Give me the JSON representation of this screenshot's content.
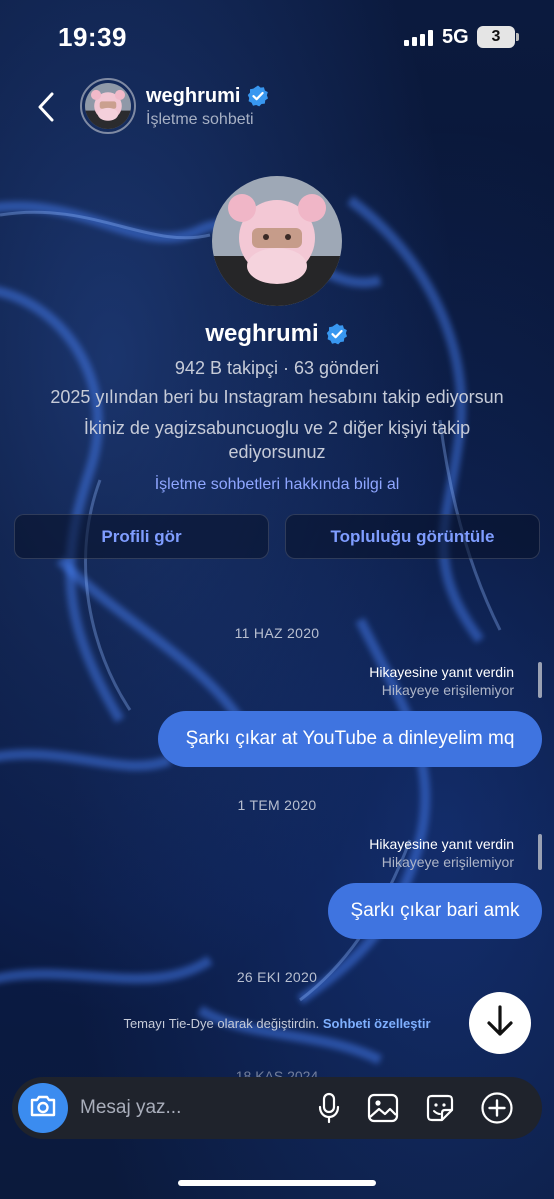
{
  "status_bar": {
    "time": "19:39",
    "network": "5G",
    "battery": "3"
  },
  "header": {
    "username": "weghrumi",
    "subtitle": "İşletme sohbeti"
  },
  "profile": {
    "username": "weghrumi",
    "stats": "942 B takipçi · 63 gönderi",
    "following_since": "2025 yılından beri bu Instagram hesabını takip ediyorsun",
    "mutual": "İkiniz de yagizsabuncuoglu ve 2 diğer kişiyi takip ediyorsunuz",
    "learn_more": "İşletme sohbetleri hakkında bilgi al",
    "view_profile_button": "Profili gör",
    "view_community_button": "Topluluğu görüntüle"
  },
  "messages": [
    {
      "date": "11 HAZ 2020",
      "reply_label": "Hikayesine yanıt verdin",
      "reply_sub": "Hikayeye erişilemiyor",
      "text": "Şarkı çıkar at YouTube a dinleyelim mq"
    },
    {
      "date": "1 TEM 2020",
      "reply_label": "Hikayesine yanıt verdin",
      "reply_sub": "Hikayeye erişilemiyor",
      "text": "Şarkı çıkar bari amk"
    }
  ],
  "theme_event": {
    "date": "26 EKI 2020",
    "text": "Temayı Tie-Dye olarak değiştirdin.",
    "link": "Sohbeti özelleştir"
  },
  "partial_date": "18 KAS 2024",
  "composer": {
    "placeholder": "Mesaj yaz..."
  },
  "colors": {
    "bubble": "#3f74e0",
    "accent_link": "#8fa6ff",
    "verified": "#3897f0",
    "camera_button": "#3b8cf0"
  },
  "icons": [
    "back-chevron-icon",
    "verified-badge-icon",
    "arrow-down-icon",
    "camera-icon",
    "microphone-icon",
    "image-icon",
    "sticker-icon",
    "plus-circle-icon"
  ]
}
